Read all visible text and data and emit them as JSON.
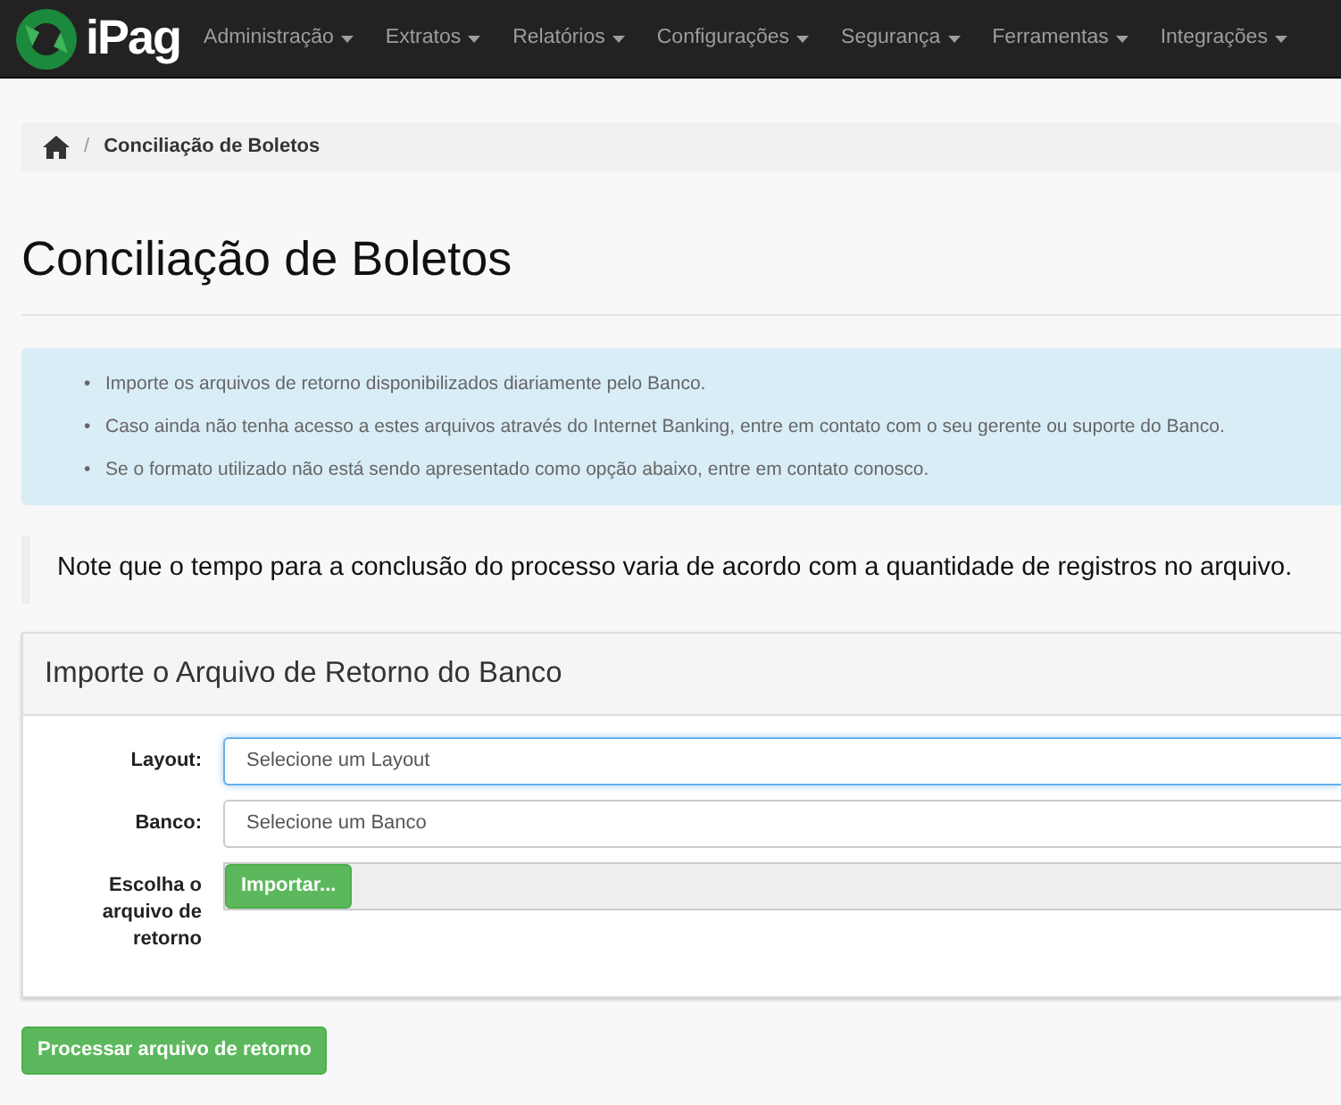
{
  "navbar": {
    "brand": "iPag",
    "menu": [
      {
        "label": "Administração"
      },
      {
        "label": "Extratos"
      },
      {
        "label": "Relatórios"
      },
      {
        "label": "Configurações"
      },
      {
        "label": "Segurança"
      },
      {
        "label": "Ferramentas"
      },
      {
        "label": "Integrações"
      }
    ]
  },
  "breadcrumb": [
    {
      "kind": "home"
    },
    {
      "kind": "separator",
      "label": "/"
    },
    {
      "kind": "text",
      "label": "Conciliação de Boletos"
    }
  ],
  "info_marker": "•",
  "title": "Conciliação de Boletos",
  "info": [
    "Importe os arquivos de retorno disponibilizados diariamente pelo Banco.",
    "Caso ainda não tenha acesso a estes arquivos através do Internet Banking, entre em contato com o seu gerente ou suporte do Banco.",
    "Se o formato utilizado não está sendo apresentado como opção abaixo, entre em contato conosco."
  ],
  "note": "Note que o tempo para a conclusão do processo varia de acordo com a quantidade de registros no arquivo.",
  "panel": {
    "heading": "Importe o Arquivo de Retorno do Banco",
    "fields": [
      {
        "kind": "select",
        "label": "Layout:",
        "value": "Selecione um Layout",
        "focused": true
      },
      {
        "kind": "select",
        "label": "Banco:",
        "value": "Selecione um Banco",
        "focused": false
      },
      {
        "kind": "file",
        "label": "Escolha o arquivo de retorno",
        "button": "Importar..."
      }
    ]
  },
  "submit": "Processar arquivo de retorno"
}
